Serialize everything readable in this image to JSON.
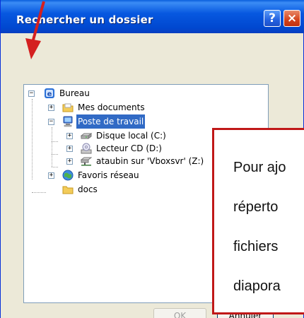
{
  "dialog": {
    "title": "Rechercher un dossier",
    "help_label": "?",
    "close_label": "×"
  },
  "tree": {
    "nodes": [
      {
        "label": "Bureau",
        "icon": "desktop-icon",
        "expander": "−"
      },
      {
        "label": "Mes documents",
        "icon": "folder-icon",
        "expander": "+"
      },
      {
        "label": "Poste de travail",
        "icon": "computer-icon",
        "expander": "−",
        "selected": true
      },
      {
        "label": "Disque local (C:)",
        "icon": "hard-drive-icon",
        "expander": "+"
      },
      {
        "label": "Lecteur CD (D:)",
        "icon": "cd-drive-icon",
        "expander": "+"
      },
      {
        "label": "ataubin sur 'Vboxsvr' (Z:)",
        "icon": "network-drive-icon",
        "expander": "+"
      },
      {
        "label": "Favoris réseau",
        "icon": "network-places-icon",
        "expander": "+"
      },
      {
        "label": "docs",
        "icon": "folder-icon",
        "expander": ""
      }
    ]
  },
  "buttons": {
    "ok": "OK",
    "cancel": "Annuler"
  },
  "callout": {
    "lines": [
      "Pour ajo",
      "réperto",
      "fichiers",
      "diapora"
    ]
  },
  "colors": {
    "titlebar": "#0055e5",
    "selection": "#316ac5",
    "callout_border": "#c01818",
    "arrow": "#d42020"
  }
}
